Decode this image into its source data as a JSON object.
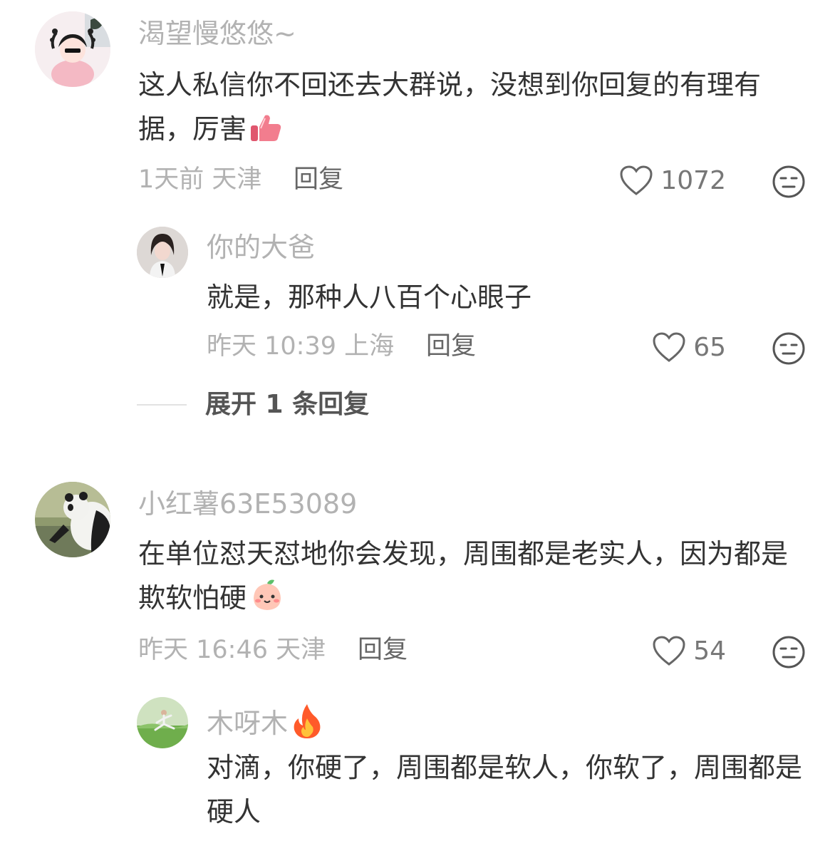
{
  "comments": [
    {
      "username": "渴望慢悠悠~",
      "text": "这人私信你不回还去大群说，没想到你回复的有理有据，厉害",
      "emoji": "thumbs-up",
      "time": "1天前",
      "location": "天津",
      "reply_label": "回复",
      "likes": "1072",
      "avatar": "cartoon-girl-avatar",
      "replies": [
        {
          "username": "你的大爸",
          "text": "就是，那种人八百个心眼子",
          "time": "昨天 10:39",
          "location": "上海",
          "reply_label": "回复",
          "likes": "65",
          "avatar": "girl-photo-avatar"
        }
      ],
      "expand_label": "展开 1 条回复"
    },
    {
      "username": "小红薯63E53089",
      "text": "在单位怼天怼地你会发现，周围都是老实人，因为都是欺软怕硬",
      "emoji": "peach-face",
      "time": "昨天 16:46",
      "location": "天津",
      "reply_label": "回复",
      "likes": "54",
      "avatar": "panda-avatar",
      "replies": [
        {
          "username": "木呀木",
          "username_emoji": "fire",
          "text": "对滴，你硬了，周围都是软人，你软了，周围都是硬人",
          "avatar": "grass-field-avatar"
        }
      ]
    }
  ],
  "colors": {
    "username": "#b2b2b2",
    "text": "#333333",
    "meta": "#b2b2b2",
    "reply": "#666666"
  }
}
